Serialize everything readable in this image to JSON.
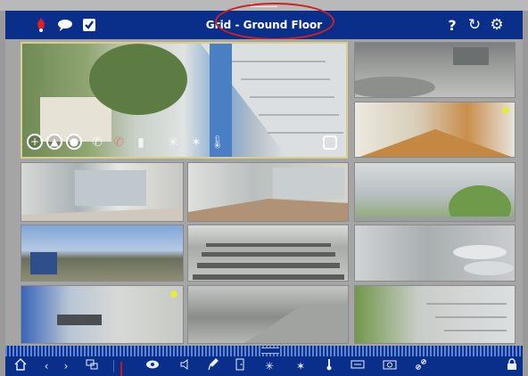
{
  "header": {
    "title": "Grid - Ground Floor",
    "icons": [
      "alarm-bell-icon",
      "chat-icon",
      "checkbox-icon",
      "help-icon",
      "refresh-icon",
      "gear-icon"
    ],
    "help_glyph": "?",
    "refresh_glyph": "↻",
    "gear_glyph": "⚙"
  },
  "colors": {
    "bar": "#0a2f8a",
    "highlight_ring": "#d1201e",
    "status_dot": "#e4ea3e"
  },
  "cameras": [
    {
      "name": "main-entrance-stairs",
      "selected": true
    },
    {
      "name": "parking-lot-top"
    },
    {
      "name": "lobby-hall"
    },
    {
      "name": "corridor-windows-1"
    },
    {
      "name": "corridor-windows-2"
    },
    {
      "name": "courtyard-tree"
    },
    {
      "name": "panorama-sky"
    },
    {
      "name": "lecture-hall"
    },
    {
      "name": "parking-cars"
    },
    {
      "name": "lounge-blue"
    },
    {
      "name": "entrance-path"
    },
    {
      "name": "stairs-outside"
    }
  ],
  "toolbar": {
    "icons": [
      "home-icon",
      "back-icon",
      "forward-icon",
      "layout-icon",
      "camera-dome-icon",
      "speaker-icon",
      "microphone-icon",
      "door-icon",
      "light-on-icon",
      "light-off-icon",
      "thermometer-icon",
      "ticket-icon",
      "snapshot-icon",
      "link-icon",
      "lock-icon"
    ]
  }
}
